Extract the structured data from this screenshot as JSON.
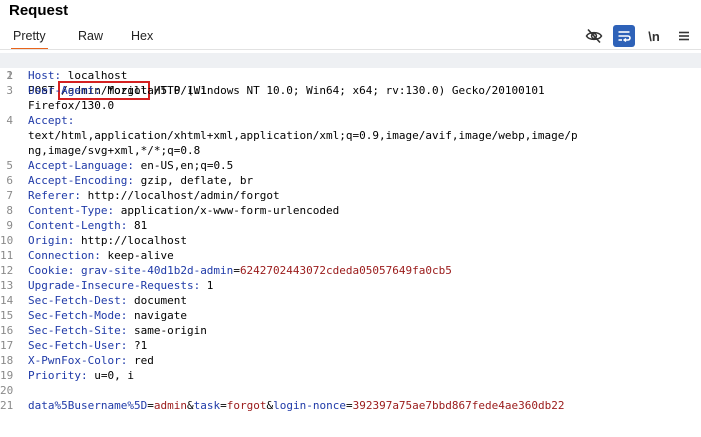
{
  "panel": {
    "title": "Request"
  },
  "tabs": [
    "Pretty",
    "Raw",
    "Hex"
  ],
  "toolbar": {
    "newline_label": "\\n"
  },
  "lines": {
    "l1": {
      "n": "1",
      "method": "POST ",
      "path": "/admin/forgot",
      "proto": " HTTP/1.1"
    },
    "l2": {
      "n": "2",
      "k": "Host:",
      "v": " localhost"
    },
    "l3": {
      "n": "3",
      "k": "User-Agent:",
      "v": " Mozilla/5.0 (Windows NT 10.0; Win64; x64; rv:130.0) Gecko/20100101"
    },
    "l3b": {
      "v": "Firefox/130.0"
    },
    "l4": {
      "n": "4",
      "k": "Accept:"
    },
    "l4b": {
      "v": "text/html,application/xhtml+xml,application/xml;q=0.9,image/avif,image/webp,image/p"
    },
    "l4c": {
      "v": "ng,image/svg+xml,*/*;q=0.8"
    },
    "l5": {
      "n": "5",
      "k": "Accept-Language:",
      "v": " en-US,en;q=0.5"
    },
    "l6": {
      "n": "6",
      "k": "Accept-Encoding:",
      "v": " gzip, deflate, br"
    },
    "l7": {
      "n": "7",
      "k": "Referer:",
      "v": " http://localhost/admin/forgot"
    },
    "l8": {
      "n": "8",
      "k": "Content-Type:",
      "v": " application/x-www-form-urlencoded"
    },
    "l9": {
      "n": "9",
      "k": "Content-Length:",
      "v": " 81"
    },
    "l10": {
      "n": "10",
      "k": "Origin:",
      "v": " http://localhost"
    },
    "l11": {
      "n": "11",
      "k": "Connection:",
      "v": " keep-alive"
    },
    "l12": {
      "n": "12",
      "k": "Cookie:",
      "cname": " grav-site-40d1b2d-admin",
      "eq": "=",
      "cval": "6242702443072cdeda05057649fa0cb5"
    },
    "l13": {
      "n": "13",
      "k": "Upgrade-Insecure-Requests:",
      "v": " 1"
    },
    "l14": {
      "n": "14",
      "k": "Sec-Fetch-Dest:",
      "v": " document"
    },
    "l15": {
      "n": "15",
      "k": "Sec-Fetch-Mode:",
      "v": " navigate"
    },
    "l16": {
      "n": "16",
      "k": "Sec-Fetch-Site:",
      "v": " same-origin"
    },
    "l17": {
      "n": "17",
      "k": "Sec-Fetch-User:",
      "v": " ?1"
    },
    "l18": {
      "n": "18",
      "k": "X-PwnFox-Color:",
      "v": " red"
    },
    "l19": {
      "n": "19",
      "k": "Priority:",
      "v": " u=0, i"
    },
    "l20": {
      "n": "20"
    },
    "l21": {
      "n": "21",
      "p1k": "data%5Busername%5D",
      "p1eq": "=",
      "p1v": "admin",
      "amp1": "&",
      "p2k": "task",
      "p2eq": "=",
      "p2v": "forgot",
      "amp2": "&",
      "p3k": "login-nonce",
      "p3eq": "=",
      "p3v": "392397a75ae7bbd867fede4ae360db22"
    }
  }
}
